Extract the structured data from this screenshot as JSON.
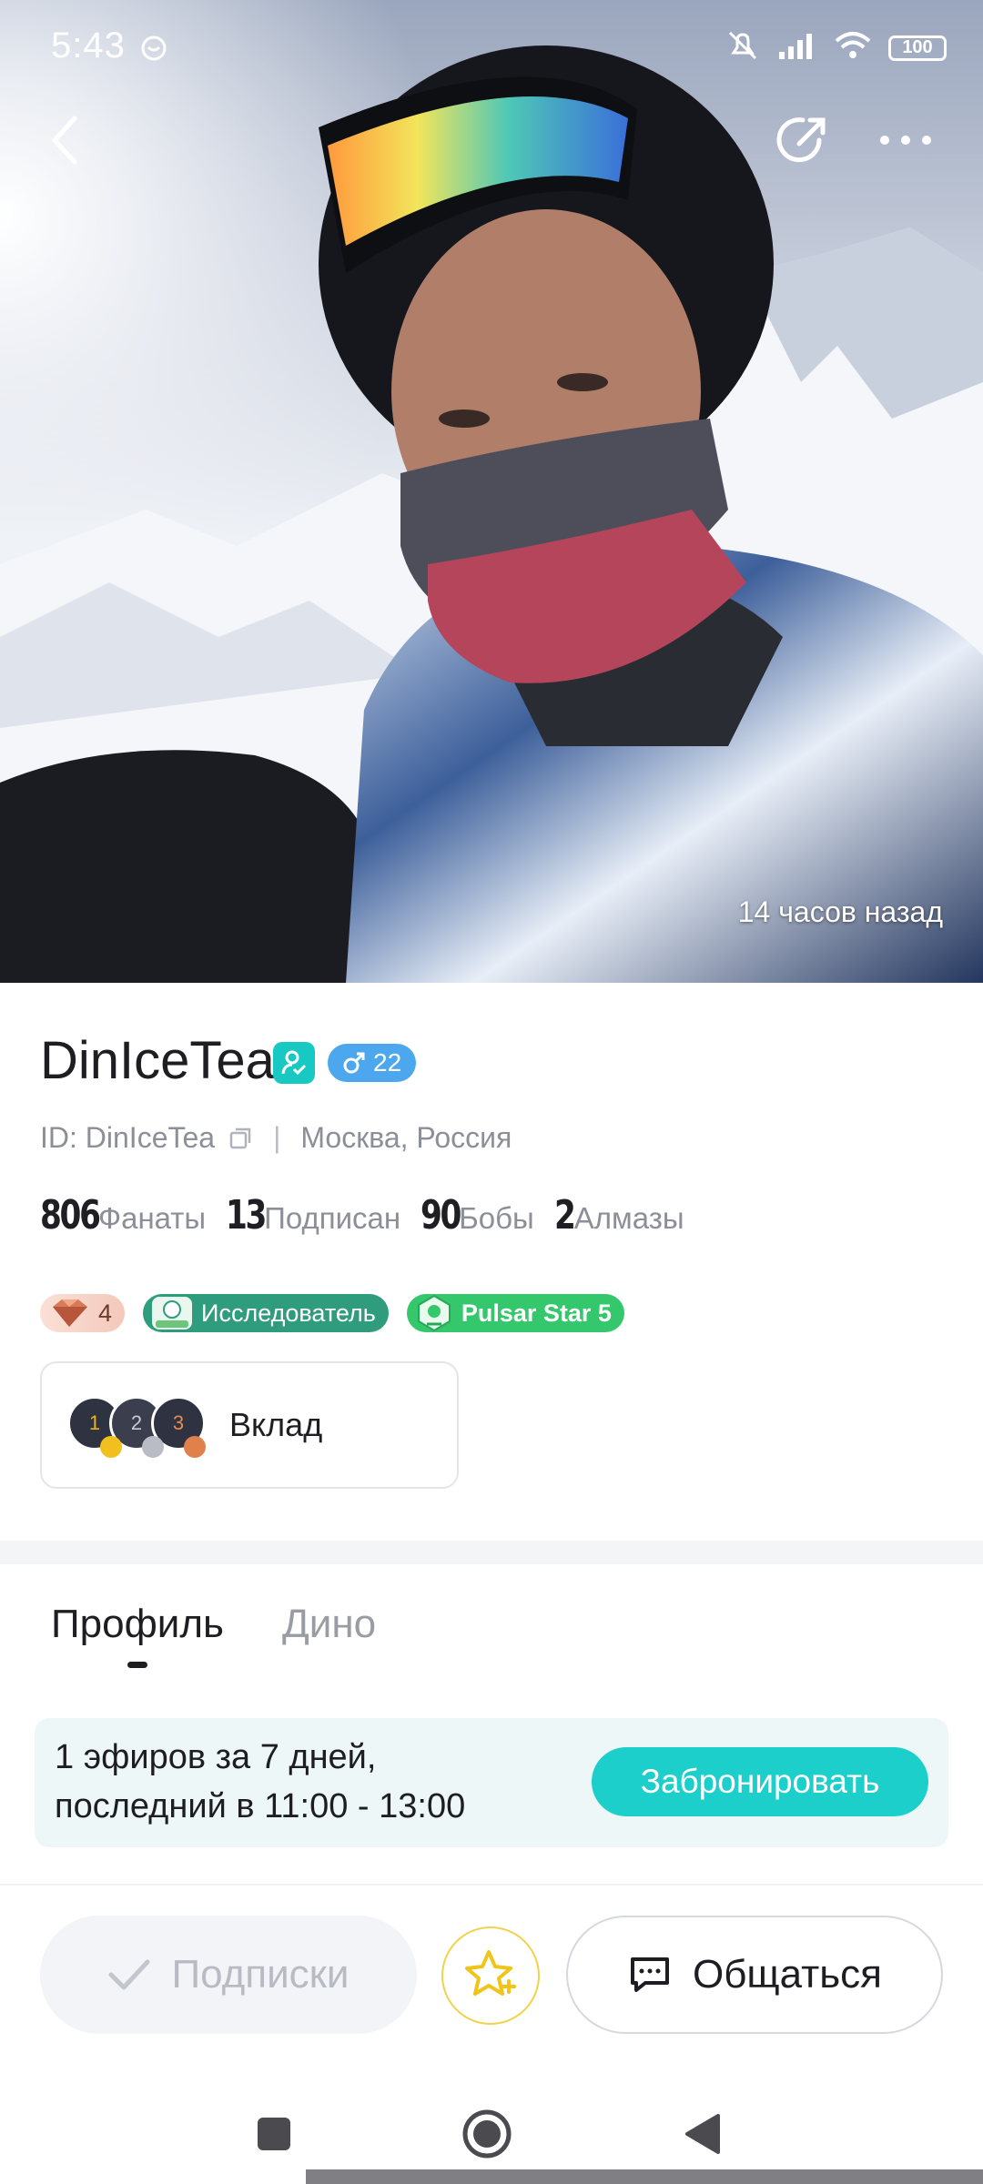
{
  "status_bar": {
    "time": "5:43",
    "battery": "100",
    "icons": [
      "silent-icon",
      "signal-icon",
      "wifi-icon",
      "battery-icon"
    ]
  },
  "hero": {
    "photo_time": "14 часов назад",
    "description_icons": [
      "back-icon",
      "share-icon",
      "more-icon"
    ]
  },
  "profile": {
    "name": "DinIceTea",
    "gender_age": "22",
    "id_label": "ID: DinIceTea",
    "location": "Москва, Россия",
    "stats": [
      {
        "value": "806",
        "label": "Фанаты"
      },
      {
        "value": "13",
        "label": "Подписан"
      },
      {
        "value": "90",
        "label": "Бобы"
      },
      {
        "value": "2",
        "label": "Алмазы"
      }
    ],
    "badges": {
      "diamond_count": "4",
      "explorer": "Исследователь",
      "pulsar": "Pulsar Star 5"
    },
    "contribution": {
      "label": "Вклад",
      "ranks": [
        "1",
        "2",
        "3"
      ]
    }
  },
  "tabs": [
    {
      "label": "Профиль",
      "active": true
    },
    {
      "label": "Дино",
      "active": false
    }
  ],
  "live_info": {
    "line1": "1 эфиров за 7 дней,",
    "line2": "последний в 11:00 - 13:00",
    "book_label": "Забронировать"
  },
  "actions": {
    "follow_label": "Подписки",
    "chat_label": "Общаться"
  },
  "colors": {
    "accent": "#1ccfca",
    "gender_badge": "#4ca7ef",
    "explorer_badge": "#2f9c7d",
    "pulsar_badge": "#34c76b"
  }
}
